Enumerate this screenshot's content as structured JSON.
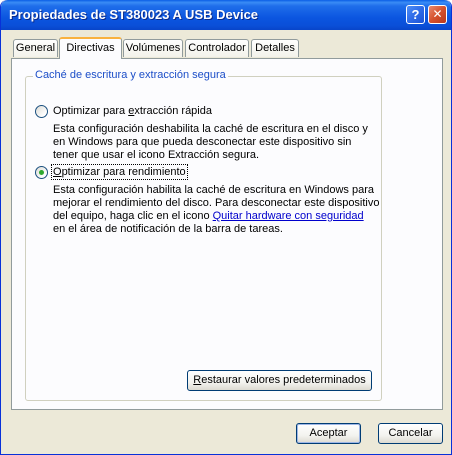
{
  "window": {
    "title": "Propiedades de ST380023 A USB Device",
    "help_button": "?",
    "close_button": "✕"
  },
  "tabs": [
    {
      "label": "General",
      "active": false
    },
    {
      "label": "Directivas",
      "active": true
    },
    {
      "label": "Volúmenes",
      "active": false
    },
    {
      "label": "Controlador",
      "active": false
    },
    {
      "label": "Detalles",
      "active": false
    }
  ],
  "group": {
    "label": "Caché de escritura y extracción segura",
    "options": [
      {
        "label_before": "Optimizar para ",
        "label_ul": "e",
        "label_after": "xtracción rápida",
        "selected": false,
        "description": [
          "Esta configuración deshabilita la caché de escritura en el disco y",
          "en Windows para que pueda desconectar este dispositivo sin",
          "tener que usar el icono Extracción segura."
        ]
      },
      {
        "label_before": "",
        "label_ul": "O",
        "label_after": "ptimizar para rendimiento",
        "selected": true,
        "description": [
          "Esta configuración habilita la caché de escritura en Windows para",
          "mejorar el rendimiento del disco. Para desconectar este dispositivo",
          "del equipo, haga clic en el icono "
        ],
        "link_text": "Quitar hardware con seguridad",
        "description_end": "en el área de notificación de la barra de tareas."
      }
    ],
    "restore_button_ul": "R",
    "restore_button_rest": "estaurar valores predeterminados"
  },
  "footer": {
    "accept_label": "Aceptar",
    "cancel_label": "Cancelar"
  }
}
